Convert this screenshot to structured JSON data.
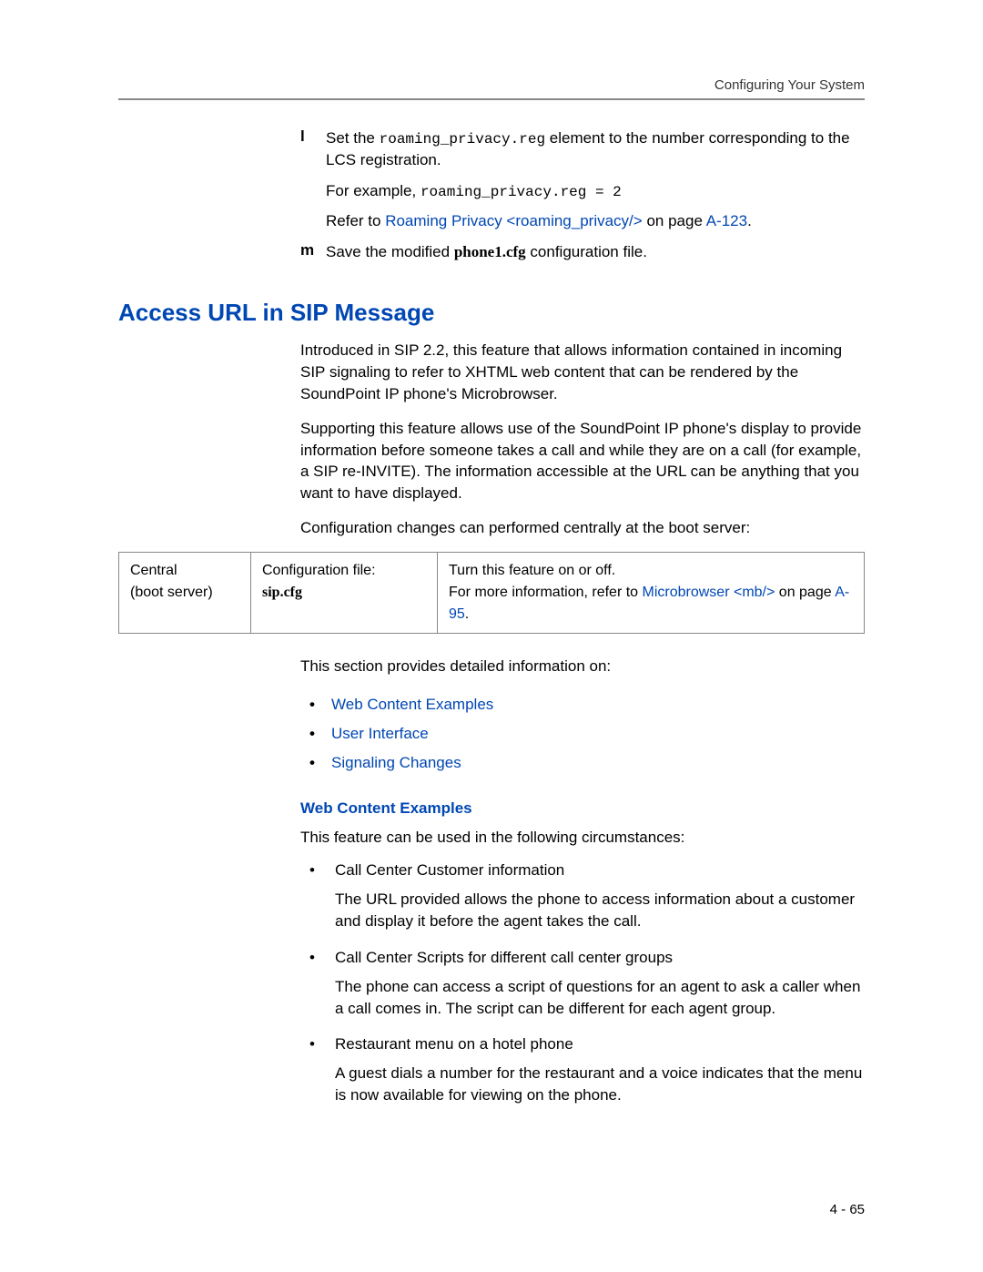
{
  "header": {
    "right": "Configuring Your System"
  },
  "steps": {
    "l": {
      "marker": "l",
      "text_prefix": "Set the ",
      "code": "roaming_privacy.reg",
      "text_suffix": " element to the number corresponding to the LCS registration.",
      "example_prefix": "For example, ",
      "example_code": "roaming_privacy.reg = 2",
      "refer_prefix": "Refer to ",
      "refer_link": "Roaming Privacy <roaming_privacy/>",
      "refer_mid": " on page ",
      "refer_page": "A-123",
      "refer_end": "."
    },
    "m": {
      "marker": "m",
      "text_prefix": "Save the modified ",
      "bold": "phone1.cfg",
      "text_suffix": " configuration file."
    }
  },
  "section": {
    "title": "Access URL in SIP Message",
    "para1": "Introduced in SIP 2.2, this feature that allows information contained in incoming SIP signaling to refer to XHTML web content that can be rendered by the SoundPoint IP phone's Microbrowser.",
    "para2": "Supporting this feature allows use of the SoundPoint IP phone's display to provide information before someone takes a call and while they are on a call (for example, a SIP re-INVITE). The information accessible at the URL can be anything that you want to have displayed.",
    "para3": "Configuration changes can performed centrally at the boot server:"
  },
  "table": {
    "r1c1_l1": "Central",
    "r1c1_l2": "(boot server)",
    "r1c2_l1": "Configuration file:",
    "r1c2_l2": "sip.cfg",
    "r1c3_l1": "Turn this feature on or off.",
    "r1c3_l2_pre": "For more information, refer to ",
    "r1c3_link": "Microbrowser <mb/>",
    "r1c3_l2_mid": " on page ",
    "r1c3_page": "A-95",
    "r1c3_l2_end": "."
  },
  "detail_intro": "This section provides detailed information on:",
  "links": {
    "a": "Web Content Examples",
    "b": "User Interface",
    "c": "Signaling Changes"
  },
  "web_examples": {
    "heading": "Web Content Examples",
    "intro": "This feature can be used in the following circumstances:",
    "items": [
      {
        "title": "Call Center Customer information",
        "desc": "The URL provided allows the phone to access information about a customer and display it before the agent takes the call."
      },
      {
        "title": "Call Center Scripts for different call center groups",
        "desc": "The phone can access a script of questions for an agent to ask a caller when a call comes in. The script can be different for each agent group."
      },
      {
        "title": "Restaurant menu on a hotel phone",
        "desc": "A guest dials a number for the restaurant and a voice indicates that the menu is now available for viewing on the phone."
      }
    ]
  },
  "footer": {
    "page": "4 - 65"
  }
}
